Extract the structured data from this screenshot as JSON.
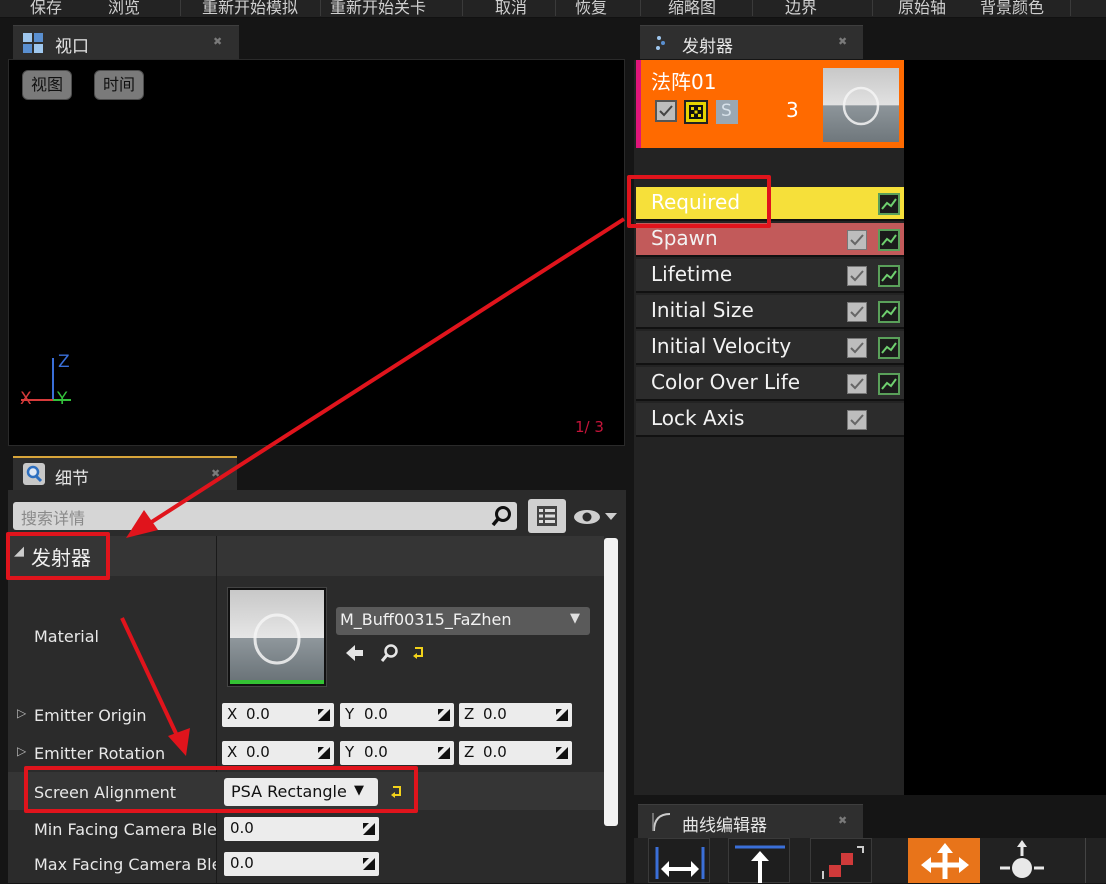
{
  "toolbar": {
    "items": [
      "保存",
      "浏览",
      "重新开始模拟",
      "重新开始关卡",
      "取消",
      "恢复",
      "缩略图",
      "边界",
      "原始轴",
      "背景颜色"
    ]
  },
  "viewport_tab": {
    "title": "视口"
  },
  "viewport": {
    "view_btn": "视图",
    "time_btn": "时间",
    "axis_z": "Z",
    "axis_x": "X",
    "axis_y": "Y",
    "lod_counter": "1/ 3"
  },
  "details_tab": {
    "title": "细节"
  },
  "details": {
    "search_placeholder": "搜索详情",
    "category": "发射器",
    "material_label": "Material",
    "material_value": "M_Buff00315_FaZhen",
    "emitter_origin_label": "Emitter Origin",
    "emitter_rotation_label": "Emitter Rotation",
    "screen_alignment_label": "Screen Alignment",
    "screen_alignment_value": "PSA Rectangle",
    "min_facing_label": "Min Facing Camera Blend",
    "max_facing_label": "Max Facing Camera Blend",
    "min_facing_value": "0.0",
    "max_facing_value": "0.0",
    "origin": {
      "x_axis": "X",
      "x": "0.0",
      "y_axis": "Y",
      "y": "0.0",
      "z_axis": "Z",
      "z": "0.0"
    },
    "rotation": {
      "x_axis": "X",
      "x": "0.0",
      "y_axis": "Y",
      "y": "0.0",
      "z_axis": "Z",
      "z": "0.0"
    }
  },
  "emitter_tab": {
    "title": "发射器"
  },
  "emitter": {
    "name": "法阵01",
    "count": "3",
    "solo_label": "S",
    "header_color": "#ff6a00",
    "modules": [
      {
        "label": "Required",
        "color": "#f6e03a"
      },
      {
        "label": "Spawn",
        "color": "#c25a5a"
      },
      {
        "label": "Lifetime",
        "color": "#2c2c2c"
      },
      {
        "label": "Initial Size",
        "color": "#2c2c2c"
      },
      {
        "label": "Initial Velocity",
        "color": "#2c2c2c"
      },
      {
        "label": "Color Over Life",
        "color": "#2c2c2c"
      },
      {
        "label": "Lock Axis",
        "color": "#2c2c2c"
      }
    ]
  },
  "curve_tab": {
    "title": "曲线编辑器"
  },
  "colors": {
    "highlight": "#e0141c",
    "accent_orange": "#e8741a"
  }
}
